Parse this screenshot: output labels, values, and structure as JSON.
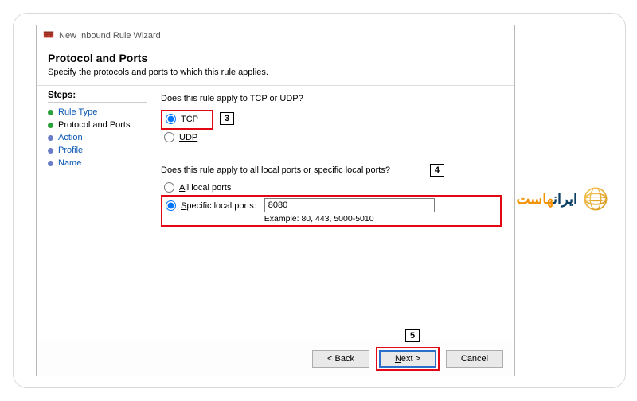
{
  "window": {
    "title": "New Inbound Rule Wizard"
  },
  "header": {
    "title": "Protocol and Ports",
    "subtitle": "Specify the protocols and ports to which this rule applies."
  },
  "sidebar": {
    "title": "Steps:",
    "items": [
      {
        "label": "Rule Type",
        "state": "link"
      },
      {
        "label": "Protocol and Ports",
        "state": "current"
      },
      {
        "label": "Action",
        "state": "pending"
      },
      {
        "label": "Profile",
        "state": "pending"
      },
      {
        "label": "Name",
        "state": "pending"
      }
    ]
  },
  "main": {
    "q1": "Does this rule apply to TCP or UDP?",
    "radio_tcp": "TCP",
    "radio_udp": "UDP",
    "q2": "Does this rule apply to all local ports or specific local ports?",
    "radio_all_ports": "All local ports",
    "radio_specific_ports": "Specific local ports:",
    "port_value": "8080",
    "example": "Example: 80, 443, 5000-5010"
  },
  "annotations": {
    "a3": "3",
    "a4": "4",
    "a5": "5"
  },
  "footer": {
    "back": "< Back",
    "next": "Next >",
    "cancel": "Cancel"
  },
  "brand": {
    "text_a": "ایران",
    "text_b": "هاست"
  }
}
